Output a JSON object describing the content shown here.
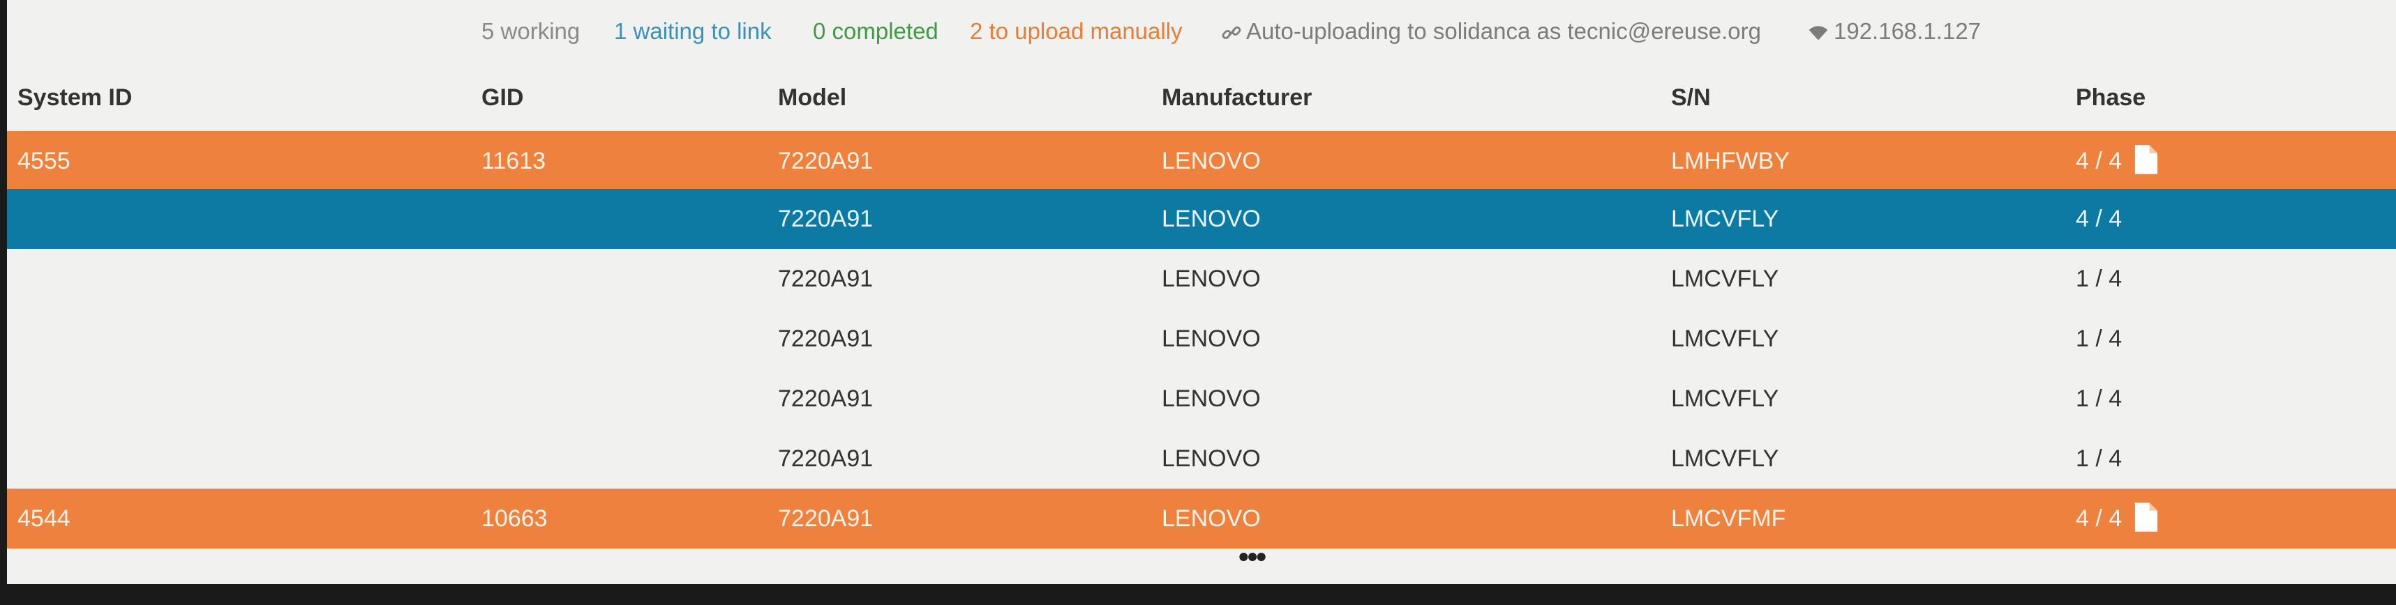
{
  "status": {
    "working": "5 working",
    "waiting": "1 waiting to link",
    "completed": "0 completed",
    "manual": "2 to upload manually",
    "auto": "Auto-uploading to solidanca as tecnic@ereuse.org",
    "ip": "192.168.1.127"
  },
  "columns": {
    "system_id": "System ID",
    "gid": "GID",
    "model": "Model",
    "manufacturer": "Manufacturer",
    "sn": "S/N",
    "phase": "Phase"
  },
  "rows": [
    {
      "system_id": "4555",
      "gid": "11613",
      "model": "7220A91",
      "manufacturer": "LENOVO",
      "sn": "LMHFWBY",
      "phase": "4 / 4",
      "state": "orange",
      "file": true
    },
    {
      "system_id": "",
      "gid": "",
      "model": "7220A91",
      "manufacturer": "LENOVO",
      "sn": "LMCVFLY",
      "phase": "4 / 4",
      "state": "blue",
      "file": false
    },
    {
      "system_id": "",
      "gid": "",
      "model": "7220A91",
      "manufacturer": "LENOVO",
      "sn": "LMCVFLY",
      "phase": "1 / 4",
      "state": "normal",
      "file": false
    },
    {
      "system_id": "",
      "gid": "",
      "model": "7220A91",
      "manufacturer": "LENOVO",
      "sn": "LMCVFLY",
      "phase": "1 / 4",
      "state": "normal",
      "file": false
    },
    {
      "system_id": "",
      "gid": "",
      "model": "7220A91",
      "manufacturer": "LENOVO",
      "sn": "LMCVFLY",
      "phase": "1 / 4",
      "state": "normal",
      "file": false
    },
    {
      "system_id": "",
      "gid": "",
      "model": "7220A91",
      "manufacturer": "LENOVO",
      "sn": "LMCVFLY",
      "phase": "1 / 4",
      "state": "normal",
      "file": false
    },
    {
      "system_id": "4544",
      "gid": "10663",
      "model": "7220A91",
      "manufacturer": "LENOVO",
      "sn": "LMCVFMF",
      "phase": "4 / 4",
      "state": "orange",
      "file": true
    }
  ],
  "more": "•••",
  "colors": {
    "orange": "#ef813e",
    "blue": "#0d7aa3",
    "background": "#f1f1f0"
  },
  "icons": {
    "auto": "link-icon",
    "ip": "wifi-icon",
    "file": "file-icon"
  }
}
